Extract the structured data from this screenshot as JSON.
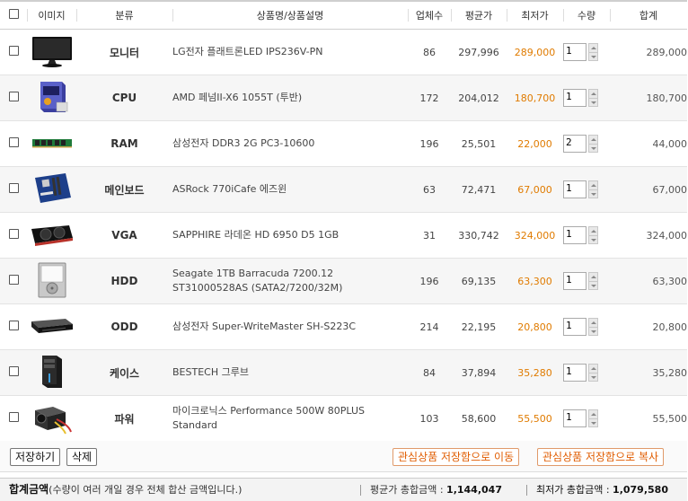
{
  "columns": {
    "image": "이미지",
    "category": "분류",
    "name": "상품명/상품설명",
    "vendors": "업체수",
    "avg": "평균가",
    "min": "최저가",
    "qty": "수량",
    "total": "합계"
  },
  "rows": [
    {
      "category": "모니터",
      "name": "LG전자 플래트론LED IPS236V-PN",
      "vendors": "86",
      "avg": "297,996",
      "min": "289,000",
      "qty": "1",
      "total": "289,000",
      "icon": "monitor-icon"
    },
    {
      "category": "CPU",
      "name": "AMD 페넘II-X6 1055T (투반)",
      "vendors": "172",
      "avg": "204,012",
      "min": "180,700",
      "qty": "1",
      "total": "180,700",
      "icon": "cpu-box-icon"
    },
    {
      "category": "RAM",
      "name": "삼성전자 DDR3 2G PC3-10600",
      "vendors": "196",
      "avg": "25,501",
      "min": "22,000",
      "qty": "2",
      "total": "44,000",
      "icon": "ram-stick-icon"
    },
    {
      "category": "메인보드",
      "name": "ASRock 770iCafe 에즈윈",
      "vendors": "63",
      "avg": "72,471",
      "min": "67,000",
      "qty": "1",
      "total": "67,000",
      "icon": "motherboard-icon"
    },
    {
      "category": "VGA",
      "name": "SAPPHIRE 라데온 HD 6950 D5 1GB",
      "vendors": "31",
      "avg": "330,742",
      "min": "324,000",
      "qty": "1",
      "total": "324,000",
      "icon": "graphics-card-icon"
    },
    {
      "category": "HDD",
      "name": "Seagate 1TB Barracuda 7200.12 ST31000528AS (SATA2/7200/32M)",
      "vendors": "196",
      "avg": "69,135",
      "min": "63,300",
      "qty": "1",
      "total": "63,300",
      "icon": "hard-drive-icon"
    },
    {
      "category": "ODD",
      "name": "삼성전자 Super-WriteMaster SH-S223C",
      "vendors": "214",
      "avg": "22,195",
      "min": "20,800",
      "qty": "1",
      "total": "20,800",
      "icon": "optical-drive-icon"
    },
    {
      "category": "케이스",
      "name": "BESTECH 그루브",
      "vendors": "84",
      "avg": "37,894",
      "min": "35,280",
      "qty": "1",
      "total": "35,280",
      "icon": "pc-case-icon"
    },
    {
      "category": "파워",
      "name": "마이크로닉스 Performance 500W 80PLUS Standard",
      "vendors": "103",
      "avg": "58,600",
      "min": "55,500",
      "qty": "1",
      "total": "55,500",
      "icon": "power-supply-icon"
    }
  ],
  "toolbar": {
    "save_label": "저장하기",
    "delete_label": "삭제",
    "move_label": "관심상품 저장함으로 이동",
    "copy_label": "관심상품 저장함으로 복사"
  },
  "summary": {
    "title": "합계금액",
    "note": "(수량이 여러 개일 경우 전체 합산 금액입니다.)",
    "avg_label": "평균가 총합금액 :",
    "avg_value": "1,144,047",
    "min_label": "최저가 총합금액 :",
    "min_value": "1,079,580"
  },
  "colors": {
    "min_price": "#e07b00",
    "orange_button_text": "#e05c00",
    "alt_row": "#f6f6f6"
  }
}
